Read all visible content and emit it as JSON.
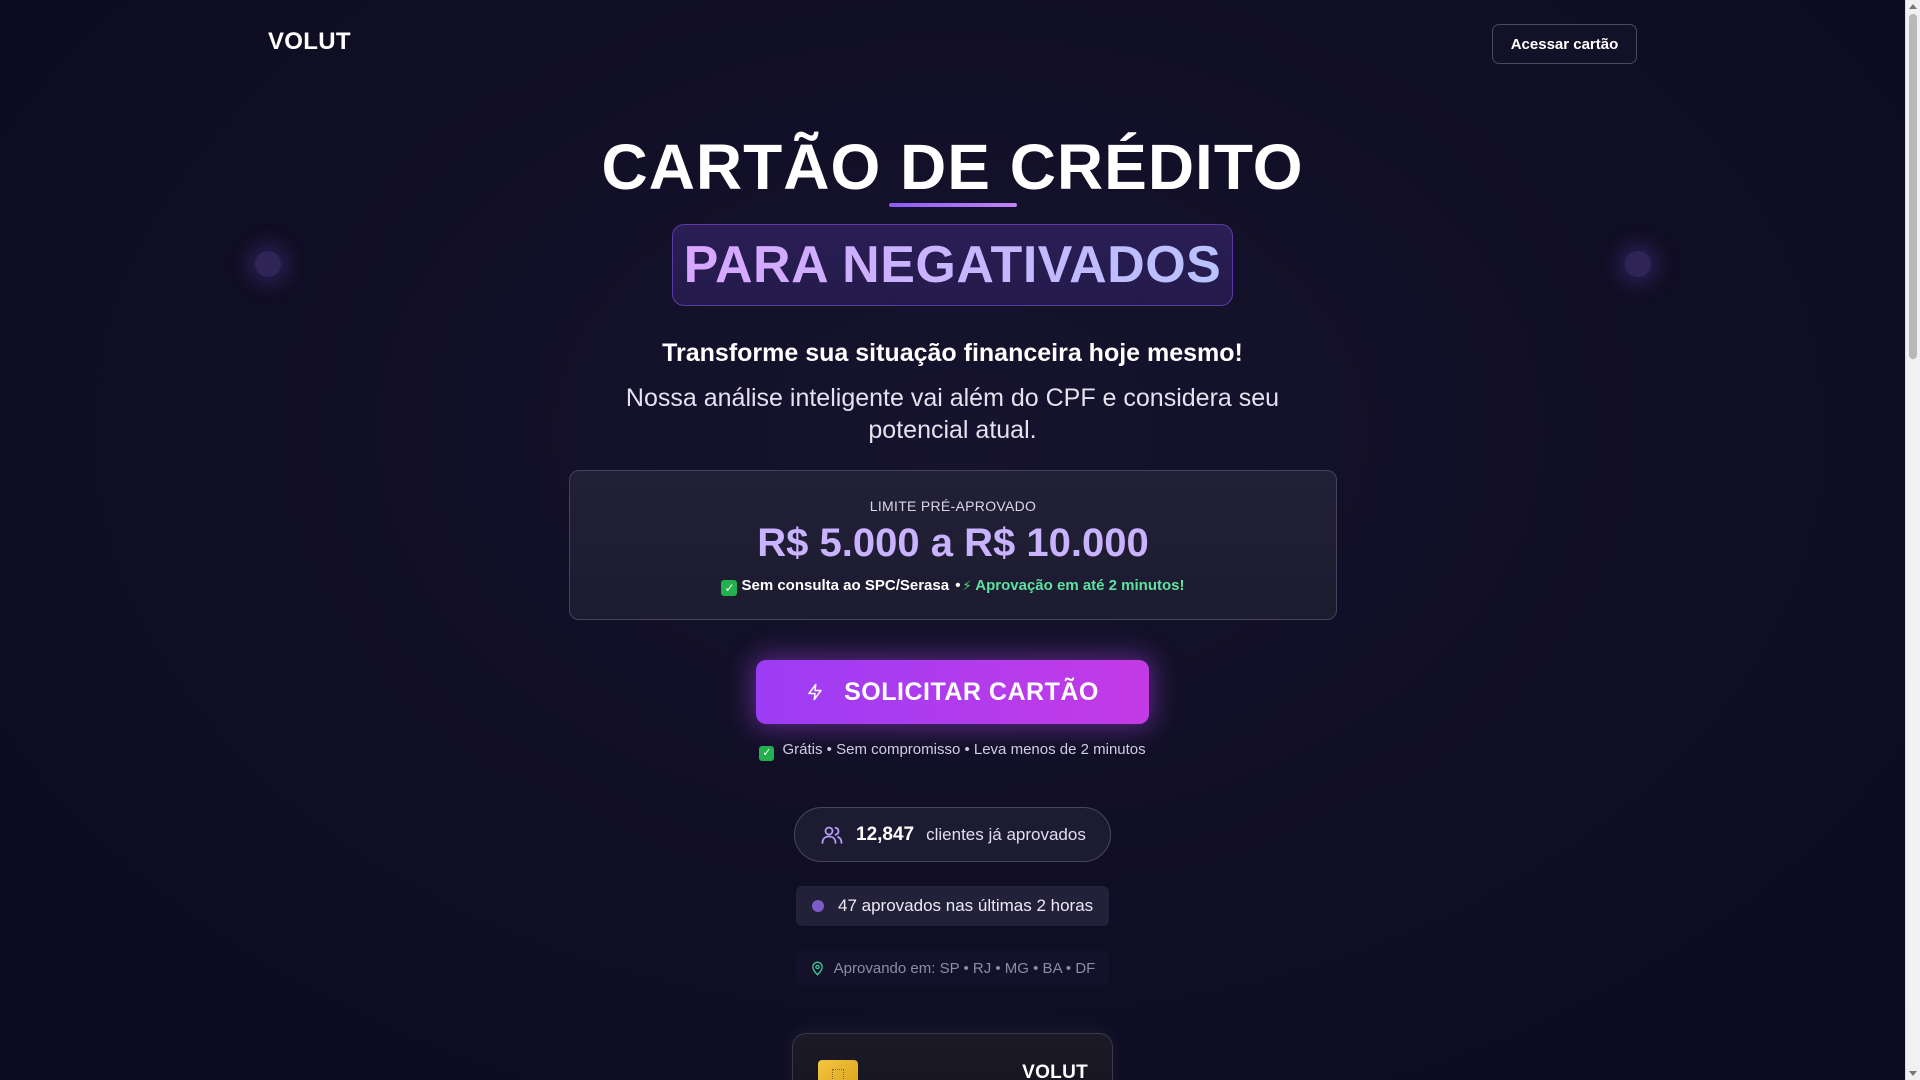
{
  "header": {
    "brand": "VOLUT",
    "access_button": "Acessar cartão"
  },
  "hero": {
    "title": "CARTÃO DE CRÉDITO",
    "badge": "PARA NEGATIVADOS",
    "subtitle": "Transforme sua situação financeira hoje mesmo!",
    "description": "Nossa análise inteligente vai além do CPF e considera seu potencial atual."
  },
  "limit_card": {
    "label": "LIMITE PRÉ-APROVADO",
    "value": "R$ 5.000 a R$ 10.000",
    "feature_1": "Sem consulta ao SPC/Serasa",
    "separator": "•",
    "feature_2": "Aprovação em até 2 minutos!"
  },
  "cta": {
    "label": "SOLICITAR CARTÃO",
    "note": "Grátis • Sem compromisso • Leva menos de 2 minutos"
  },
  "stats": {
    "count": "12,847",
    "count_label": "clientes já aprovados",
    "recent": "47 aprovados nas últimas 2 horas",
    "regions": "Aprovando em: SP • RJ • MG • BA • DF"
  },
  "card_preview": {
    "brand": "VOLUT"
  },
  "icons": {
    "check": "check-icon",
    "bolt": "bolt-icon",
    "users": "users-icon",
    "pin": "map-pin-icon",
    "chip": "card-chip-icon"
  },
  "colors": {
    "background": "#0f0d22",
    "accent_purple": "#a855f7",
    "badge_text": "#d8a6ff",
    "limit_value": "#c9b3ff",
    "success_green": "#5ee2a0"
  }
}
